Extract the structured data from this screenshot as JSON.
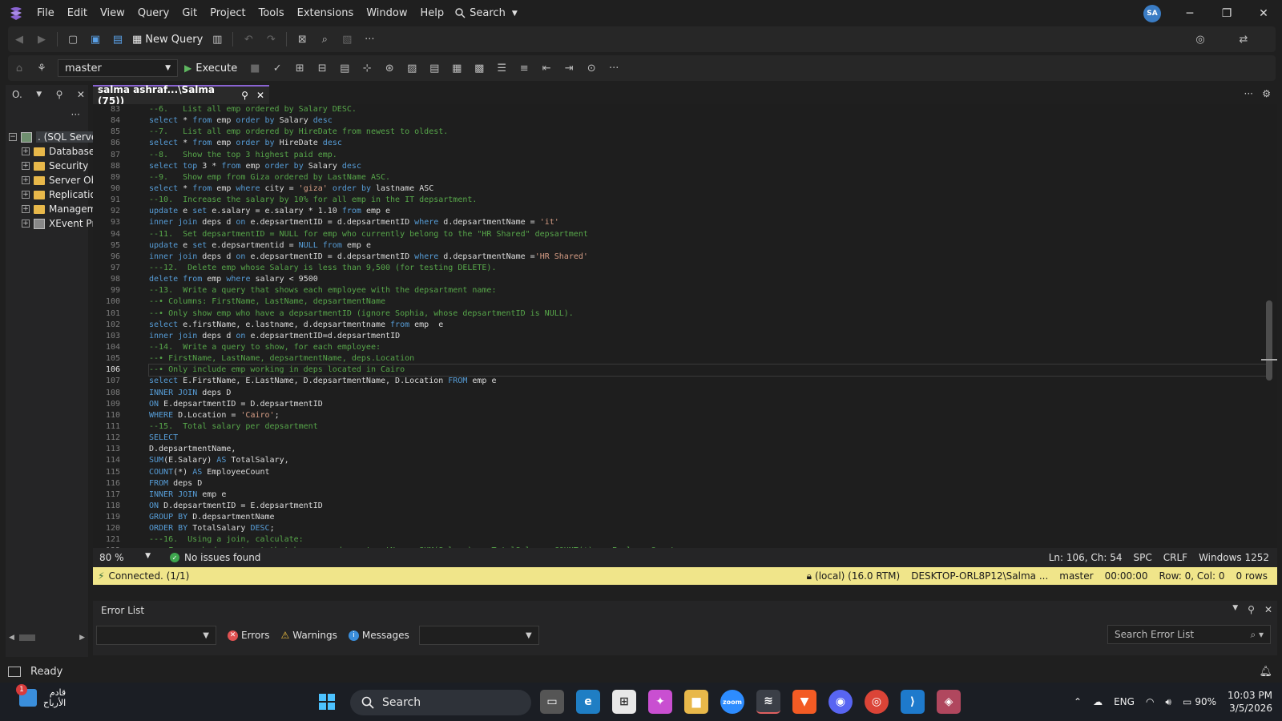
{
  "menu": {
    "items": [
      "File",
      "Edit",
      "View",
      "Query",
      "Git",
      "Project",
      "Tools",
      "Extensions",
      "Window",
      "Help"
    ],
    "search_label": "Search",
    "user_initials": "SA"
  },
  "toolbar": {
    "new_query_label": "New Query",
    "database": "master",
    "execute_label": "Execute"
  },
  "object_explorer": {
    "title": "O.",
    "more": "···",
    "nodes": [
      ". (SQL Server",
      "Database",
      "Security",
      "Server Ob",
      "Replicatio",
      "Managem",
      "XEvent Pr"
    ]
  },
  "editor": {
    "tab_title": "salma ashraf...\\Salma (75))",
    "first_line_number": 83,
    "current_line": 106,
    "lines": [
      "--6.   List all emp ordered by Salary DESC.",
      "select * from emp order by Salary desc",
      "--7.   List all emp ordered by HireDate from newest to oldest.",
      "select * from emp order by HireDate desc",
      "--8.   Show the top 3 highest paid emp.",
      "select top 3 * from emp order by Salary desc",
      "--9.   Show emp from Giza ordered by LastName ASC.",
      "select * from emp where city = 'giza' order by lastname ASC",
      "--10.  Increase the salary by 10% for all emp in the IT depsartment.",
      "update e set e.salary = e.salary * 1.10 from emp e",
      "inner join deps d on e.depsartmentID = d.depsartmentID where d.depsartmentName = 'it'",
      "--11.  Set depsartmentID = NULL for emp who currently belong to the \"HR Shared\" depsartment",
      "update e set e.depsartmentid = NULL from emp e",
      "inner join deps d on e.depsartmentID = d.depsartmentID where d.depsartmentName ='HR Shared'",
      "---12.  Delete emp whose Salary is less than 9,500 (for testing DELETE).",
      "delete from emp where salary < 9500",
      "--13.  Write a query that shows each employee with the depsartment name:",
      "--• Columns: FirstName, LastName, depsartmentName",
      "--• Only show emp who have a depsartmentID (ignore Sophia, whose depsartmentID is NULL).",
      "select e.firstName, e.lastname, d.depsartmentname from emp  e",
      "inner join deps d on e.depsartmentID=d.depsartmentID",
      "--14.  Write a query to show, for each employee:",
      "--• FirstName, LastName, depsartmentName, deps.Location",
      "--• Only include emp working in deps located in Cairo",
      "select E.FirstName, E.LastName, D.depsartmentName, D.Location FROM emp e",
      "INNER JOIN deps D",
      "ON E.depsartmentID = D.depsartmentID",
      "WHERE D.Location = 'Cairo';",
      "--15.  Total salary per depsartment",
      "SELECT",
      "D.depsartmentName,",
      "SUM(E.Salary) AS TotalSalary,",
      "COUNT(*) AS EmployeeCount",
      "FROM deps D",
      "INNER JOIN emp e",
      "ON D.depsartmentID = E.depsartmentID",
      "GROUP BY D.depsartmentName",
      "ORDER BY TotalSalary DESC;",
      "---16.  Using a join, calculate:",
      "--• For each depsartment that has emp: depsartmentName, SUM(Salary) as TotalSalary, COUNT(*) as EmployeeCount"
    ]
  },
  "editor_status": {
    "zoom": "80 %",
    "issues": "No issues found",
    "position": "Ln: 106, Ch: 54",
    "indent": "SPC",
    "line_ending": "CRLF",
    "encoding": "Windows 1252"
  },
  "connection": {
    "status": "Connected. (1/1)",
    "server": "(local) (16.0 RTM)",
    "user": "DESKTOP-ORL8P12\\Salma ...",
    "database": "master",
    "elapsed": "00:00:00",
    "row_col": "Row: 0, Col: 0",
    "rows": "0 rows"
  },
  "error_list": {
    "title": "Error List",
    "errors_label": "Errors",
    "warnings_label": "Warnings",
    "messages_label": "Messages",
    "search_placeholder": "Search Error List"
  },
  "status_bar": {
    "text": "Ready"
  },
  "taskbar": {
    "weather_line1": "قادم",
    "weather_line2": "الأرباح",
    "weather_badge": "1",
    "search_label": "Search",
    "language": "ENG",
    "battery": "90%",
    "time": "10:03 PM",
    "date": "3/5/2026"
  },
  "colors": {
    "accent": "#8a63d2",
    "connection_bar": "#f0e58a",
    "comment": "#57a64a",
    "keyword": "#569cd6",
    "string": "#d69d85"
  }
}
